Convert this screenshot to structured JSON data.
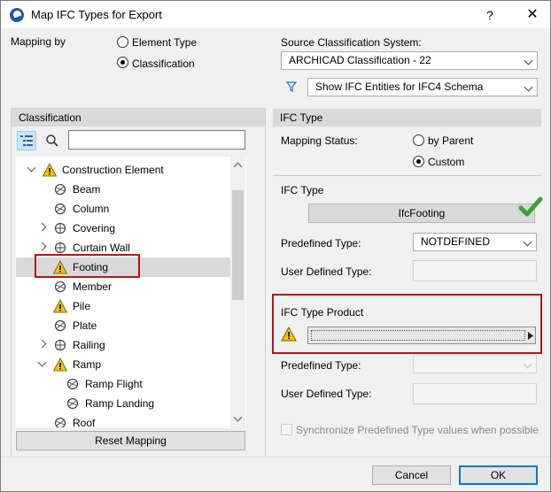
{
  "window": {
    "title": "Map IFC Types for Export",
    "help": "?",
    "close": "✕"
  },
  "mapping_by": {
    "label": "Mapping by",
    "options": [
      {
        "label": "Element Type",
        "selected": false
      },
      {
        "label": "Classification",
        "selected": true
      }
    ]
  },
  "source": {
    "label": "Source Classification System:",
    "value": "ARCHICAD Classification - 22",
    "filter_value": "Show IFC Entities for IFC4 Schema"
  },
  "left": {
    "header": "Classification",
    "search_placeholder": "",
    "tree": [
      {
        "label": "Construction Element",
        "level": 0,
        "expander": "open",
        "icon": "warning-classification-icon"
      },
      {
        "label": "Beam",
        "level": 1,
        "expander": "none",
        "icon": "classification-element-icon"
      },
      {
        "label": "Column",
        "level": 1,
        "expander": "none",
        "icon": "classification-element-icon"
      },
      {
        "label": "Covering",
        "level": 1,
        "expander": "closed",
        "icon": "classification-branch-icon"
      },
      {
        "label": "Curtain Wall",
        "level": 1,
        "expander": "closed",
        "icon": "classification-branch-icon"
      },
      {
        "label": "Footing",
        "level": 1,
        "expander": "none",
        "icon": "warning-classification-icon",
        "selected": true
      },
      {
        "label": "Member",
        "level": 1,
        "expander": "none",
        "icon": "classification-element-icon"
      },
      {
        "label": "Pile",
        "level": 1,
        "expander": "none",
        "icon": "warning-classification-icon"
      },
      {
        "label": "Plate",
        "level": 1,
        "expander": "none",
        "icon": "classification-element-icon"
      },
      {
        "label": "Railing",
        "level": 1,
        "expander": "closed",
        "icon": "classification-branch-icon"
      },
      {
        "label": "Ramp",
        "level": 1,
        "expander": "open",
        "icon": "warning-classification-icon"
      },
      {
        "label": "Ramp Flight",
        "level": 2,
        "expander": "none",
        "icon": "classification-element-icon"
      },
      {
        "label": "Ramp Landing",
        "level": 2,
        "expander": "none",
        "icon": "classification-element-icon"
      },
      {
        "label": "Roof",
        "level": 1,
        "expander": "none",
        "icon": "classification-element-icon"
      }
    ],
    "reset_button": "Reset Mapping"
  },
  "right": {
    "header": "IFC Type",
    "mapping_status": {
      "label": "Mapping Status:",
      "options": [
        {
          "label": "by Parent",
          "selected": false
        },
        {
          "label": "Custom",
          "selected": true
        }
      ]
    },
    "ifc_type": {
      "label": "IFC Type",
      "value": "IfcFooting",
      "predefined_label": "Predefined Type:",
      "predefined_value": "NOTDEFINED",
      "user_defined_label": "User Defined Type:"
    },
    "ifc_type_product": {
      "label": "IFC Type Product",
      "value": "",
      "predefined_label": "Predefined Type:",
      "user_defined_label": "User Defined Type:"
    },
    "sync_label": "Synchronize Predefined Type values when possible"
  },
  "footer": {
    "cancel": "Cancel",
    "ok": "OK"
  },
  "colors": {
    "highlight_red": "#b5161c",
    "check_green": "#3aa335",
    "warning_yellow": "#f5c400",
    "filter_blue": "#2a7fd4"
  }
}
